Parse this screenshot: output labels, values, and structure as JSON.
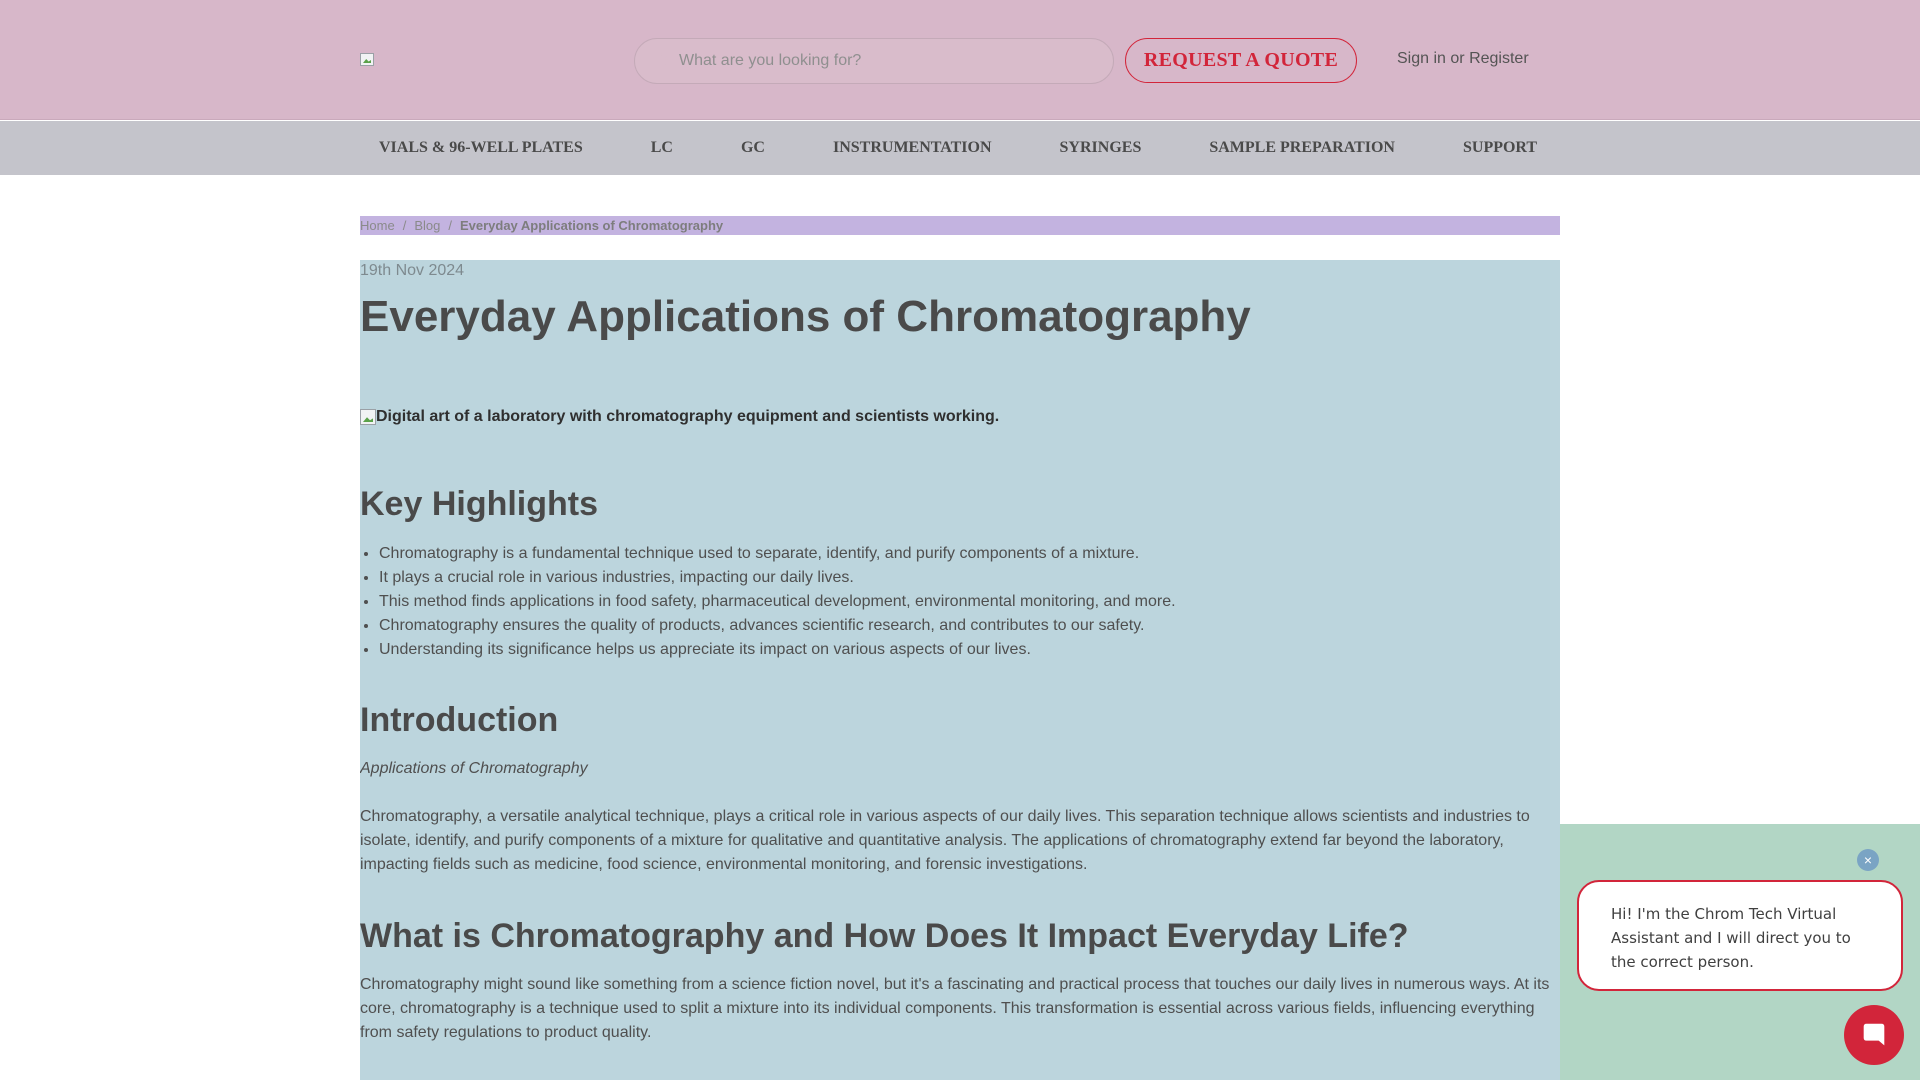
{
  "header": {
    "logo_name": "image-icon",
    "search_placeholder": "What are you looking for?",
    "quote_button": "REQUEST A QUOTE",
    "sign_in": "Sign in",
    "or": "or",
    "register": "Register"
  },
  "nav": {
    "items": [
      "VIALS & 96-WELL PLATES",
      "LC",
      "GC",
      "INSTRUMENTATION",
      "SYRINGES",
      "SAMPLE PREPARATION",
      "SUPPORT"
    ]
  },
  "breadcrumb": {
    "home": "Home",
    "separator": "/",
    "blog": "Blog",
    "current": "Everyday Applications of Chromatography"
  },
  "article": {
    "date": "19th Nov 2024",
    "title": "Everyday Applications of Chromatography",
    "hero_alt": "Digital art of a laboratory with chromatography equipment and scientists working.",
    "key_highlights_heading": "Key Highlights",
    "highlights": [
      "Chromatography is a fundamental technique used to separate, identify, and purify components of a mixture.",
      "It plays a crucial role in various industries, impacting our daily lives.",
      "This method finds applications in food safety, pharmaceutical development, environmental monitoring, and more.",
      "Chromatography ensures the quality of products, advances scientific research, and contributes to our safety.",
      "Understanding its significance helps us appreciate its impact on various aspects of our lives."
    ],
    "intro_heading": "Introduction",
    "intro_italic": "Applications of Chromatography",
    "intro_paragraph": "Chromatography, a versatile analytical technique, plays a critical role in various aspects of our daily lives. This separation technique allows scientists and industries to isolate, identify, and purify components of a mixture for qualitative and quantitative analysis. The applications of chromatography extend far beyond the laboratory, impacting fields such as medicine, food science, environmental monitoring, and forensic investigations.",
    "what_heading": "What is Chromatography and How Does It Impact Everyday Life?",
    "what_paragraph": "Chromatography might sound like something from a science fiction novel, but it's a fascinating and practical process that touches our daily lives in numerous ways. At its core, chromatography is a technique used to split a mixture into its individual components. This transformation is essential across various fields, influencing everything from safety regulations to product quality."
  },
  "chat": {
    "close_symbol": "×",
    "message": "Hi! I'm the Chrom Tech Virtual Assistant and I will direct you to the correct person.",
    "accent_color": "#d2253a"
  }
}
